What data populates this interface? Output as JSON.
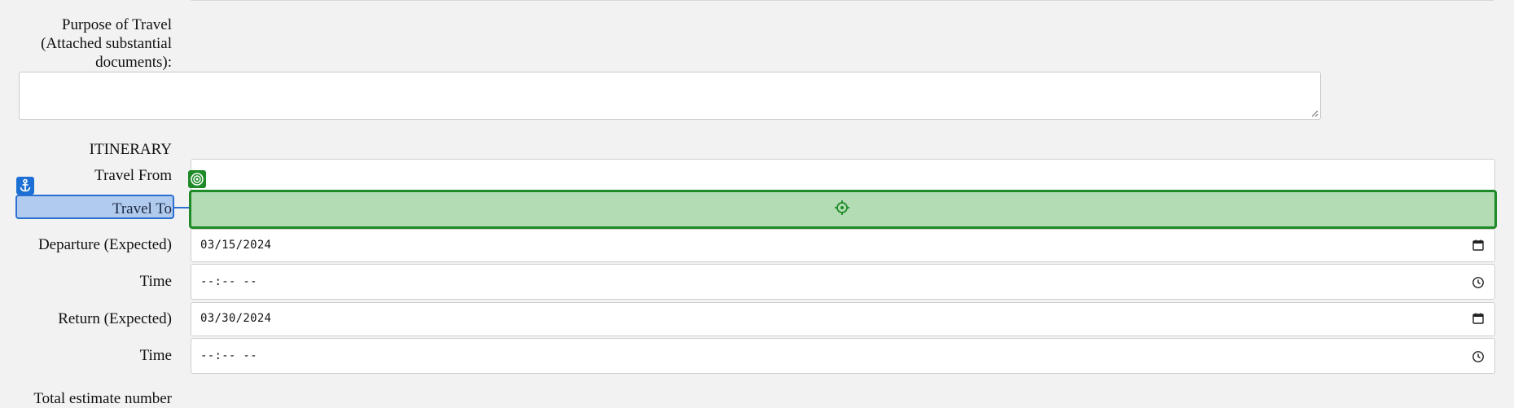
{
  "form": {
    "purpose_label": "Purpose of Travel (Attached substantial documents):",
    "purpose_value": "",
    "itinerary_heading": "ITINERARY",
    "travel_from_label": "Travel From",
    "travel_from_value": "",
    "travel_to_label": "Travel To",
    "travel_to_value": "",
    "departure_label": "Departure (Expected)",
    "departure_value": "03/15/2024",
    "departure_time_label": "Time",
    "departure_time_value": "--:-- --",
    "return_label": "Return (Expected)",
    "return_value": "03/30/2024",
    "return_time_label": "Time",
    "return_time_value": "--:-- --",
    "total_estimate_label": "Total estimate number"
  },
  "icons": {
    "calendar": "calendar-icon",
    "clock": "clock-icon",
    "anchor": "anchor-icon",
    "target": "target-icon",
    "crosshair": "crosshair-icon",
    "resize": "resize-grip-icon"
  },
  "colors": {
    "page_bg": "#f2f2f2",
    "highlight_green_fill": "#b3dcb5",
    "highlight_green_border": "#1e8a28",
    "highlight_blue_fill": "#b1cbee",
    "highlight_blue_border": "#2a6fd1"
  }
}
